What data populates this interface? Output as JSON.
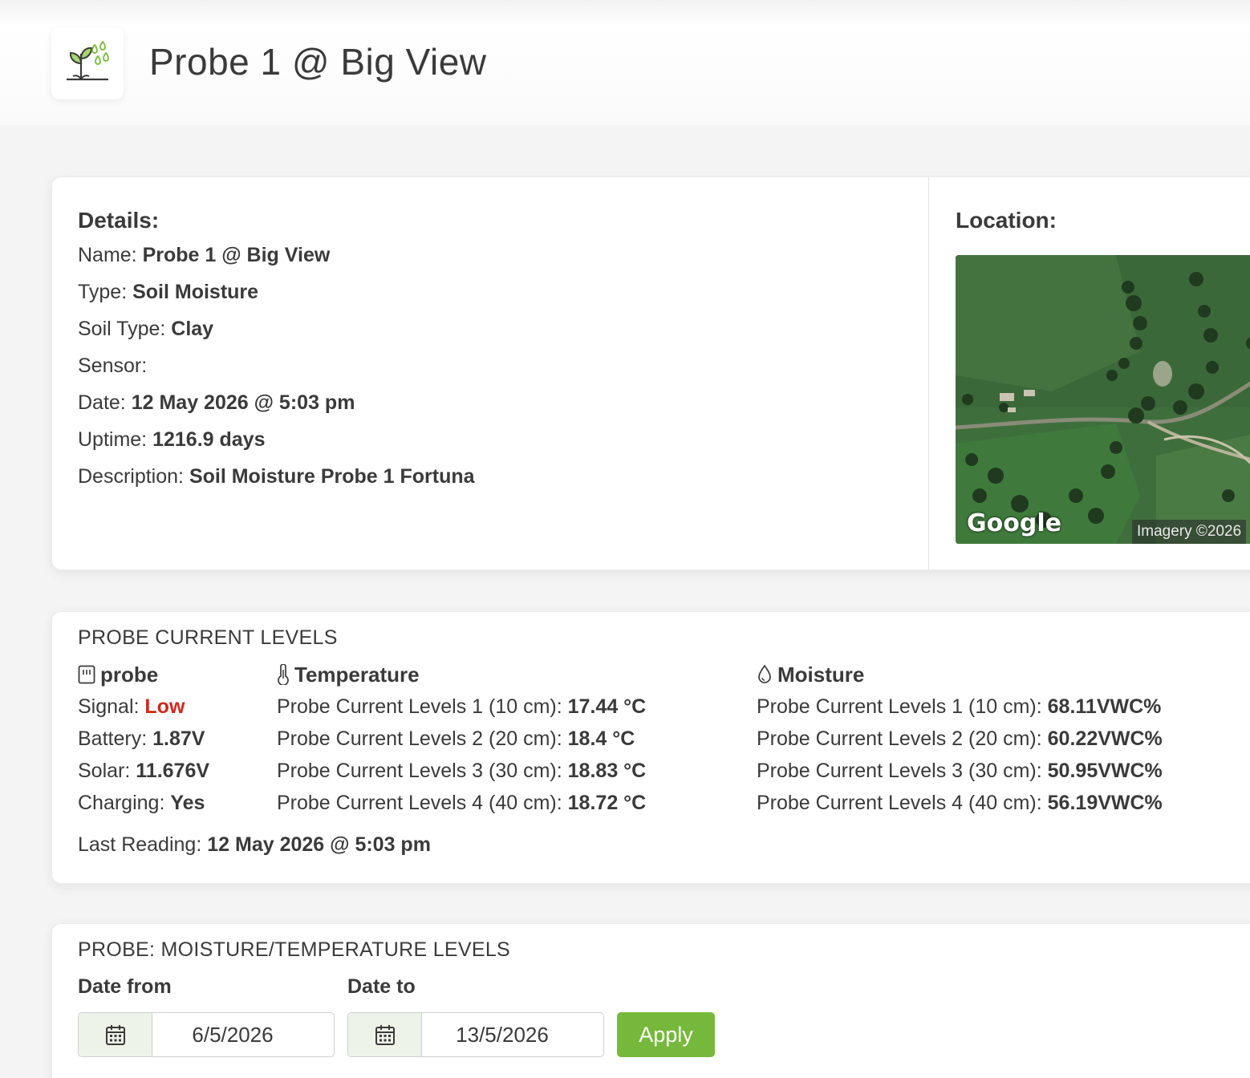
{
  "header": {
    "logo_icon": "plant-water-drops-icon",
    "title": "Probe 1 @ Big View"
  },
  "details": {
    "heading": "Details:",
    "name_label": "Name:",
    "name_value": "Probe 1 @ Big View",
    "type_label": "Type:",
    "type_value": "Soil Moisture",
    "soil_label": "Soil Type:",
    "soil_value": "Clay",
    "sensor_label": "Sensor:",
    "sensor_value": "",
    "date_label": "Date:",
    "date_value": "12 May 2026 @ 5:03 pm",
    "uptime_label": "Uptime:",
    "uptime_value": "1216.9 days",
    "desc_label": "Description:",
    "desc_value": "Soil Moisture Probe 1 Fortuna"
  },
  "location": {
    "heading": "Location:",
    "map_brand": "Google",
    "map_credit": "Imagery ©2026"
  },
  "levels": {
    "title": "PROBE CURRENT LEVELS",
    "probe": {
      "heading": "probe",
      "icon": "sim-card-icon",
      "signal_label": "Signal:",
      "signal_value": "Low",
      "battery_label": "Battery:",
      "battery_value": "1.87V",
      "solar_label": "Solar:",
      "solar_value": "11.676V",
      "charging_label": "Charging:",
      "charging_value": "Yes"
    },
    "temperature": {
      "heading": "Temperature",
      "icon": "thermometer-icon",
      "rows": [
        {
          "label": "Probe Current Levels 1 (10 cm):",
          "value": "17.44 °C"
        },
        {
          "label": "Probe Current Levels 2 (20 cm):",
          "value": "18.4 °C"
        },
        {
          "label": "Probe Current Levels 3 (30 cm):",
          "value": "18.83 °C"
        },
        {
          "label": "Probe Current Levels 4 (40 cm):",
          "value": "18.72 °C"
        }
      ]
    },
    "moisture": {
      "heading": "Moisture",
      "icon": "water-drop-icon",
      "rows": [
        {
          "label": "Probe Current Levels 1 (10 cm):",
          "value": "68.11VWC%"
        },
        {
          "label": "Probe Current Levels 2 (20 cm):",
          "value": "60.22VWC%"
        },
        {
          "label": "Probe Current Levels 3 (30 cm):",
          "value": "50.95VWC%"
        },
        {
          "label": "Probe Current Levels 4 (40 cm):",
          "value": "56.19VWC%"
        }
      ]
    },
    "last_reading_label": "Last Reading:",
    "last_reading_value": "12 May 2026 @ 5:03 pm"
  },
  "chart_panel": {
    "title": "PROBE: MOISTURE/TEMPERATURE LEVELS",
    "date_from_label": "Date from",
    "date_from_value": "6/5/2026",
    "date_to_label": "Date to",
    "date_to_value": "13/5/2026",
    "apply_label": "Apply"
  },
  "colors": {
    "accent_green": "#76b83b",
    "signal_low": "#d0281b"
  }
}
